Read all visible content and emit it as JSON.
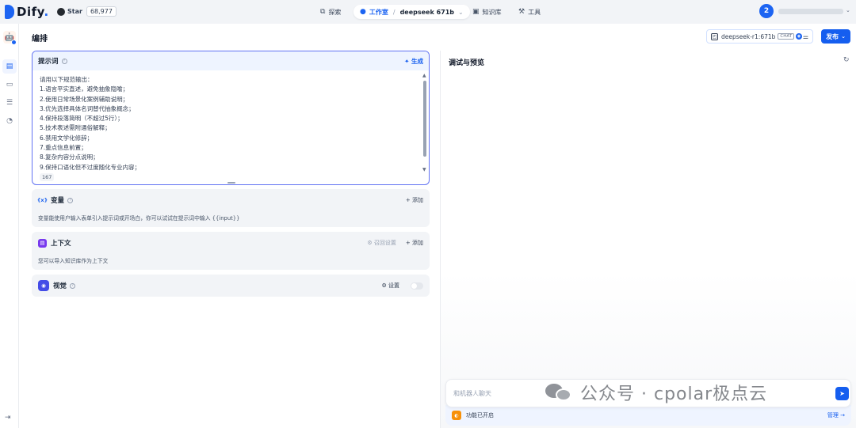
{
  "brand": {
    "name": "Dify",
    "suffix": "."
  },
  "github": {
    "label": "Star",
    "count": "68,977"
  },
  "nav": {
    "explore": "探索",
    "studio": "工作室",
    "app_name": "deepseek 671b",
    "knowledge": "知识库",
    "tools": "工具"
  },
  "user": {
    "avatar_initial": "2"
  },
  "page": {
    "title": "编排"
  },
  "model": {
    "name": "deepseek-r1:671b",
    "mode_tag": "CHAT"
  },
  "publish_label": "发布",
  "prompt": {
    "title": "提示词",
    "generate_label": "生成",
    "lines": [
      "请用以下规范输出：",
      "1.语言平实直述，避免抽象隐喻；",
      "2.使用日常场景化案例辅助说明；",
      "3.优先选择具体名词替代抽象概念；",
      "4.保持段落简明（不超过5行）；",
      "5.技术表述需附通俗解释；",
      "6.禁用文学化修辞；",
      "7.重点信息前置；",
      "8.复杂内容分点说明；",
      "9.保持口语化但不过度随化专业内容；"
    ],
    "char_count": "167"
  },
  "variables": {
    "title": "变量",
    "add_label": "添加",
    "description": "变量能使用户输入表单引入提示词或开场白，你可以试试在提示词中输入 {{input}}"
  },
  "context": {
    "title": "上下文",
    "recall_label": "召回设置",
    "add_label": "添加",
    "description": "您可以导入知识库作为上下文"
  },
  "vision": {
    "title": "视觉",
    "settings_label": "设置",
    "enabled": false
  },
  "debug": {
    "title": "调试与预览",
    "input_placeholder": "和机器人聊天",
    "feature_status": "功能已开启",
    "manage_label": "管理"
  },
  "watermark": {
    "text": "公众号 · cpolar极点云"
  },
  "colors": {
    "accent": "#155eef",
    "prompt_border": "#6172f3",
    "feature_icon": "#f79009"
  }
}
